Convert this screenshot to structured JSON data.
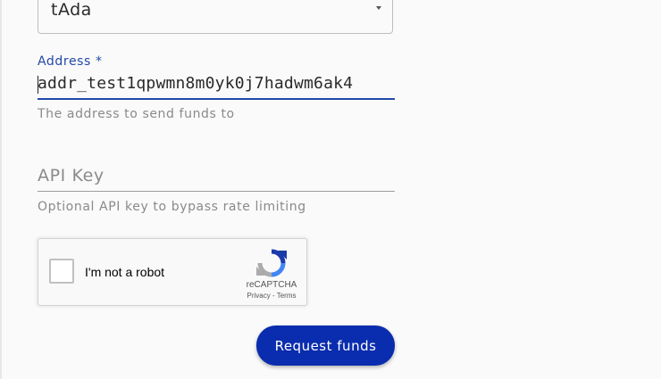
{
  "currency_select": {
    "value": "tAda"
  },
  "address": {
    "label": "Address *",
    "value": "addr_test1qpwmn8m0yk0j7hadwm6ak4",
    "helper": "The address to send funds to"
  },
  "api_key": {
    "placeholder": "API Key",
    "helper": "Optional API key to bypass rate limiting"
  },
  "recaptcha": {
    "label": "I'm not a robot",
    "brand": "reCAPTCHA",
    "links": "Privacy - Terms"
  },
  "submit": {
    "label": "Request funds"
  },
  "colors": {
    "accent": "#2249a8",
    "button": "#0a2cae"
  }
}
